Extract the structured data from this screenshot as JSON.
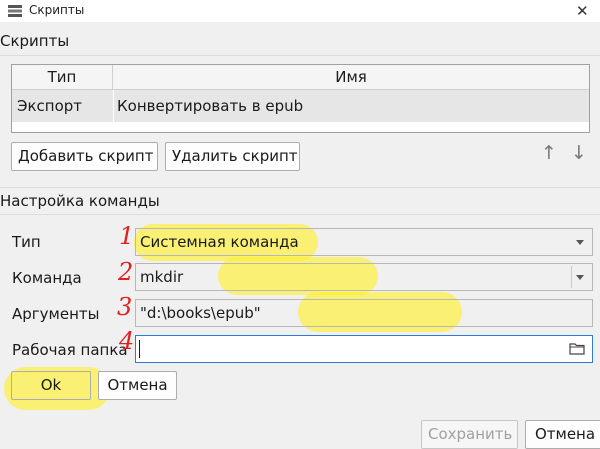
{
  "window": {
    "title": "Скрипты"
  },
  "scripts_section": {
    "label": "Скрипты"
  },
  "table": {
    "columns": [
      "Тип",
      "Имя"
    ],
    "rows": [
      {
        "type": "Экспорт",
        "name": "Конвертировать в epub"
      }
    ]
  },
  "script_buttons": {
    "add": "Добавить скрипт",
    "delete": "Удалить скрипт"
  },
  "command_section": {
    "label": "Настройка команды",
    "fields": {
      "type": {
        "label": "Тип",
        "value": "Системная команда"
      },
      "command": {
        "label": "Команда",
        "value": "mkdir"
      },
      "arguments": {
        "label": "Аргументы",
        "value": "\"d:\\books\\epub\""
      },
      "workdir": {
        "label": "Рабочая папка",
        "value": ""
      }
    },
    "ok": "Ok",
    "cancel": "Отмена"
  },
  "dialog_buttons": {
    "save": "Сохранить",
    "cancel": "Отмена"
  },
  "annotations": [
    "1",
    "2",
    "3",
    "4"
  ],
  "colors": {
    "highlight": "#fff028",
    "annotation": "#e02020",
    "focus": "#2f7ad8"
  },
  "icons": [
    "app-icon",
    "close-icon",
    "arrow-up-icon",
    "arrow-down-icon",
    "chevron-down-icon",
    "folder-icon"
  ]
}
